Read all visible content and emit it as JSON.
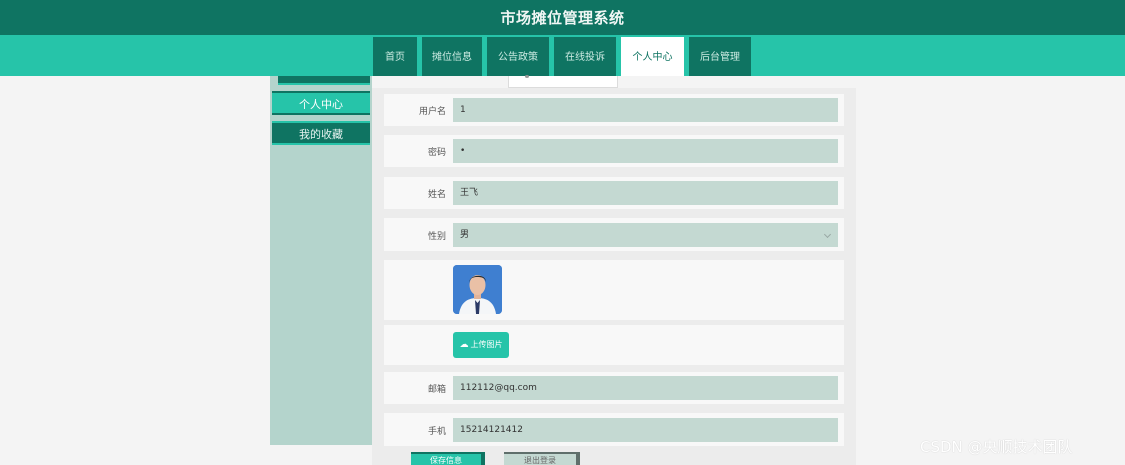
{
  "app": {
    "title": "市场摊位管理系统"
  },
  "nav": {
    "items": [
      {
        "label": "首页"
      },
      {
        "label": "摊位信息"
      },
      {
        "label": "公告政策"
      },
      {
        "label": "在线投诉"
      },
      {
        "label": "个人中心",
        "active": true
      },
      {
        "label": "后台管理"
      }
    ]
  },
  "sidebar": {
    "items": [
      {
        "label": "个人中心",
        "active": true
      },
      {
        "label": "我的收藏"
      }
    ]
  },
  "form": {
    "username": {
      "label": "用户名",
      "value": "1"
    },
    "password": {
      "label": "密码",
      "value": "•"
    },
    "name": {
      "label": "姓名",
      "value": "王飞"
    },
    "gender": {
      "label": "性别",
      "value": "男"
    },
    "upload": {
      "label": "上传图片",
      "icon": "cloud-upload-icon"
    },
    "email": {
      "label": "邮箱",
      "value": "112112@qq.com"
    },
    "phone": {
      "label": "手机",
      "value": "15214121412"
    }
  },
  "buttons": {
    "save": "保存信息",
    "logout": "退出登录"
  },
  "watermark": "CSDN @央顺技术团队",
  "colors": {
    "primary_dark": "#0f7462",
    "primary": "#26c4a9",
    "field_bg": "#c4d9d2",
    "sidebar_bg": "#b4d4cc"
  }
}
